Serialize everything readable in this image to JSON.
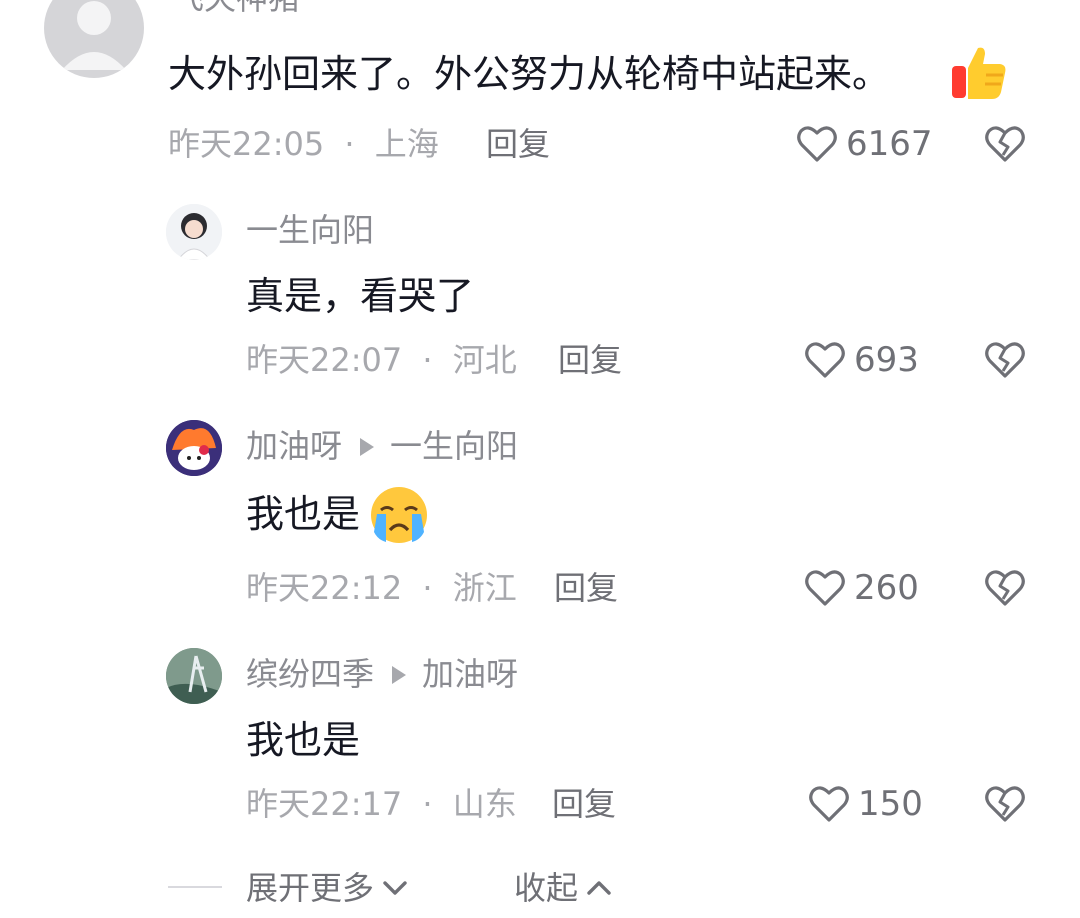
{
  "comments": [
    {
      "author": "飞天神猪",
      "text": "大外孙回来了。外公努力从轮椅中站起来。",
      "time": "昨天22:05",
      "location": "上海",
      "reply_label": "回复",
      "likes": "6167"
    },
    {
      "author": "一生向阳",
      "text": "真是，看哭了",
      "time": "昨天22:07",
      "location": "河北",
      "reply_label": "回复",
      "likes": "693"
    },
    {
      "author": "加油呀",
      "reply_to": "一生向阳",
      "text": "我也是",
      "time": "昨天22:12",
      "location": "浙江",
      "reply_label": "回复",
      "likes": "260"
    },
    {
      "author": "缤纷四季",
      "reply_to": "加油呀",
      "text": "我也是",
      "time": "昨天22:17",
      "location": "山东",
      "reply_label": "回复",
      "likes": "150"
    }
  ],
  "meta_separator": "·",
  "footer": {
    "expand_label": "展开更多",
    "collapse_label": "收起"
  },
  "icons": {
    "like": "heart-outline-icon",
    "dislike": "broken-heart-icon",
    "thumbs_up_emoji": "thumbs-up-emoji",
    "crying_emoji": "crying-face-emoji",
    "expand": "chevron-down-icon",
    "collapse": "chevron-up-icon"
  }
}
